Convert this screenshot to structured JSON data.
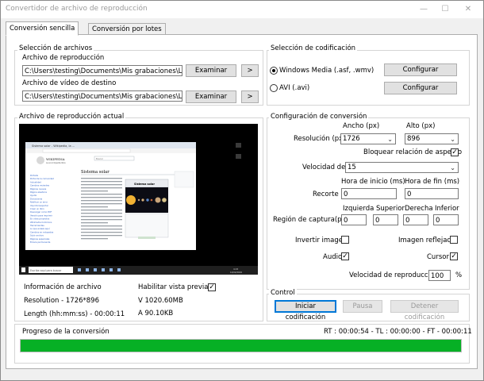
{
  "window": {
    "title": "Convertidor de archivo de reproducción"
  },
  "tabs": [
    {
      "label": "Conversión sencilla",
      "active": true
    },
    {
      "label": "Conversión por lotes",
      "active": false
    }
  ],
  "files": {
    "group_label": "Selección de archivos",
    "playback_label": "Archivo de reproducción",
    "playback_value": "C:\\Users\\testing\\Documents\\Mis grabaciones\\Local_2",
    "dest_label": "Archivo de vídeo de destino",
    "dest_value": "C:\\Users\\testing\\Documents\\Mis grabaciones\\Local_2",
    "browse_label": "Examinar",
    "arrow_label": ">"
  },
  "codec": {
    "group_label": "Selección de codificación",
    "wmv_label": "Windows Media (.asf, .wmv)",
    "avi_label": "AVI (.avi)",
    "selected": "wmv",
    "configure_label": "Configurar"
  },
  "current": {
    "group_label": "Archivo de reproducción actual",
    "info_label": "Información de archivo",
    "resolution_text": "Resolution - 1726*896",
    "length_text": "Length (hh:mm:ss) - 00:00:11",
    "preview_label": "Habilitar vista previa",
    "preview_checked": true,
    "video_text": "V 1020.60MB",
    "audio_text": "A 90.10KB"
  },
  "config": {
    "group_label": "Configuración de conversión",
    "width_header": "Ancho (px)",
    "height_header": "Alto (px)",
    "resolution_label": "Resolución (px)",
    "width_value": "1726",
    "height_value": "896",
    "lock_label": "Bloquear relación de aspecto",
    "lock_checked": true,
    "speed_label": "Velocidad de",
    "speed_value": "15",
    "start_header": "Hora de inicio (ms)",
    "end_header": "Hora de fin (ms)",
    "trim_label": "Recorte",
    "start_value": "0",
    "end_value": "0",
    "left_header": "Izquierda",
    "top_header": "Superior",
    "right_header": "Derecha",
    "bottom_header": "Inferior",
    "capture_label": "Región de captura(px)",
    "left_value": "0",
    "top_value": "0",
    "right_value": "0",
    "bottom_value": "0",
    "invert_label": "Invertir imagen",
    "invert_checked": false,
    "mirror_label": "Imagen reflejada",
    "mirror_checked": false,
    "audio_label": "Audio",
    "audio_checked": true,
    "cursor_label": "Cursor",
    "cursor_checked": true,
    "playback_speed_label": "Velocidad de reproducción",
    "playback_speed_value": "100",
    "percent": "%"
  },
  "control": {
    "group_label": "Control",
    "start_label": "Iniciar codificación",
    "pause_label": "Pausa",
    "stop_label": "Detener codificación"
  },
  "progress": {
    "label": "Progreso de la conversión",
    "status": "RT : 00:00:54 - TL : 00:00:00 - FT - 00:00:11",
    "percent": 100,
    "color": "#06b025"
  },
  "icons": {
    "minimize": "—",
    "maximize": "☐",
    "close": "✕",
    "check": "✓",
    "chevron": "⌄"
  },
  "preview_image": {
    "window_title": "Sistema solar - Wikipedia, la ...",
    "logo_text": "WIKIPEDIA",
    "logo_sub": "La enciclopedia libre",
    "article_title": "Sistema solar",
    "search_text": "Buscar",
    "infobox_title": "Sistema solar",
    "taskbar_search": "Escribe aquí para buscar",
    "taskbar_time": "4:15",
    "taskbar_date": "12/02/2019",
    "left_nav": [
      "Portada",
      "Portal de la comunidad",
      "Actualidad",
      "Cambios recientes",
      "Páginas nuevas",
      "Página aleatoria",
      "Ayuda",
      "Donaciones",
      "Notificar un error",
      "Imprimir/exportar",
      "Crear un libro",
      "Descargar como PDF",
      "Versión para imprimir",
      "En otros proyectos",
      "Wikimedia Commons",
      "Herramientas",
      "Lo que enlaza aquí",
      "Cambios en enlazadas",
      "Subir archivo",
      "Páginas especiales",
      "Enlace permanente"
    ]
  }
}
